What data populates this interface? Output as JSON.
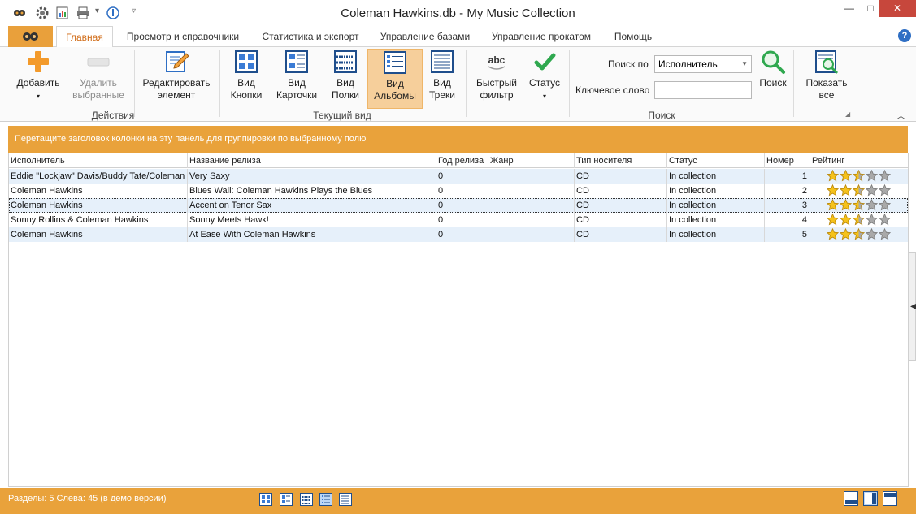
{
  "window": {
    "title": "Coleman Hawkins.db - My Music Collection",
    "quick_access_icons": [
      "app-logo-icon",
      "gear-icon",
      "report-icon",
      "print-icon",
      "info-icon",
      "customize-icon"
    ],
    "controls": [
      "minimize-icon",
      "maximize-icon",
      "close-icon"
    ]
  },
  "tabs": [
    {
      "label": "Главная",
      "active": true
    },
    {
      "label": "Просмотр и справочники",
      "active": false
    },
    {
      "label": "Статистика и экспорт",
      "active": false
    },
    {
      "label": "Управление базами",
      "active": false
    },
    {
      "label": "Управление прокатом",
      "active": false
    },
    {
      "label": "Помощь",
      "active": false
    }
  ],
  "ribbon": {
    "actions": {
      "label": "Действия",
      "add": "Добавить",
      "delete_line1": "Удалить",
      "delete_line2": "выбранные",
      "edit_line1": "Редактировать",
      "edit_line2": "элемент"
    },
    "views": {
      "label": "Текущий вид",
      "items": [
        {
          "line1": "Вид",
          "line2": "Кнопки",
          "icon": "view-buttons-icon",
          "selected": false
        },
        {
          "line1": "Вид",
          "line2": "Карточки",
          "icon": "view-cards-icon",
          "selected": false
        },
        {
          "line1": "Вид",
          "line2": "Полки",
          "icon": "view-shelves-icon",
          "selected": false
        },
        {
          "line1": "Вид",
          "line2": "Альбомы",
          "icon": "view-albums-icon",
          "selected": true
        },
        {
          "line1": "Вид",
          "line2": "Треки",
          "icon": "view-tracks-icon",
          "selected": false
        }
      ]
    },
    "search": {
      "label": "Поиск",
      "quick_filter_line1": "Быстрый",
      "quick_filter_line2": "фильтр",
      "status": "Статус",
      "search_by_label": "Поиск по",
      "search_by_value": "Исполнитель",
      "keyword_label": "Ключевое слово",
      "keyword_value": "",
      "search_button": "Поиск",
      "show_all_line1": "Показать",
      "show_all_line2": "все"
    }
  },
  "group_band_text": "Перетащите заголовок колонки на эту панель для группировки по выбранному полю",
  "grid": {
    "columns": [
      "Исполнитель",
      "Название релиза",
      "Год релиза",
      "Жанр",
      "Тип носителя",
      "Статус",
      "Номер",
      "Рейтинг"
    ],
    "rows": [
      {
        "artist": "Eddie \"Lockjaw\" Davis/Buddy Tate/Coleman Hawkins",
        "title": "Very Saxy",
        "year": "0",
        "genre": "",
        "media": "CD",
        "status": "In collection",
        "number": "1",
        "rating": 2.5
      },
      {
        "artist": "Coleman Hawkins",
        "title": "Blues Wail: Coleman Hawkins Plays the Blues",
        "year": "0",
        "genre": "",
        "media": "CD",
        "status": "In collection",
        "number": "2",
        "rating": 2.5
      },
      {
        "artist": "Coleman Hawkins",
        "title": "Accent on Tenor Sax",
        "year": "0",
        "genre": "",
        "media": "CD",
        "status": "In collection",
        "number": "3",
        "rating": 2.5
      },
      {
        "artist": "Sonny Rollins & Coleman Hawkins",
        "title": "Sonny Meets Hawk!",
        "year": "0",
        "genre": "",
        "media": "CD",
        "status": "In collection",
        "number": "4",
        "rating": 2.5
      },
      {
        "artist": "Coleman Hawkins",
        "title": "At Ease With Coleman Hawkins",
        "year": "0",
        "genre": "",
        "media": "CD",
        "status": "In collection",
        "number": "5",
        "rating": 2.5
      }
    ]
  },
  "statusbar": {
    "text": "Разделы: 5  Слева: 45 (в демо версии)",
    "view_icons": [
      "view-buttons-icon",
      "view-cards-icon",
      "view-shelves-icon",
      "view-albums-icon",
      "view-tracks-icon"
    ],
    "layout_icons": [
      "layout-bottom-icon",
      "layout-right-icon",
      "layout-top-icon"
    ]
  },
  "colors": {
    "accent_orange": "#e9a23b",
    "row_alt": "#e6f0fa",
    "selected_view": "#f6cf9b",
    "active_tab_text": "#d06a14"
  }
}
